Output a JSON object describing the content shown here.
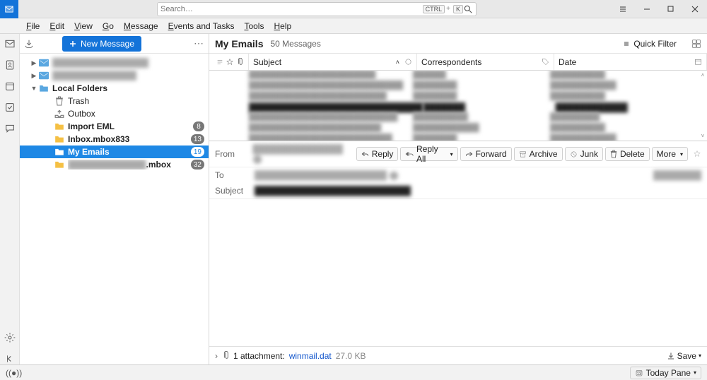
{
  "search": {
    "placeholder": "Search…",
    "kbd1": "CTRL",
    "kbd2": "K"
  },
  "menu": {
    "file": "File",
    "edit": "Edit",
    "view": "View",
    "go": "Go",
    "message": "Message",
    "events": "Events and Tasks",
    "tools": "Tools",
    "help": "Help"
  },
  "newMessage": "New Message",
  "tree": {
    "localFolders": "Local Folders",
    "trash": "Trash",
    "outbox": "Outbox",
    "importEML": {
      "label": "Import EML",
      "badge": "8"
    },
    "inboxMbox": {
      "label": "Inbox.mbox833",
      "badge": "13"
    },
    "myEmails": {
      "label": "My Emails",
      "badge": "19"
    },
    "hiddenMbox": {
      "suffix": ".mbox",
      "badge": "32"
    }
  },
  "main": {
    "title": "My Emails",
    "count": "50 Messages",
    "quickFilter": "Quick Filter",
    "cols": {
      "subject": "Subject",
      "corr": "Correspondents",
      "date": "Date"
    }
  },
  "preview": {
    "from": "From",
    "to": "To",
    "subject": "Subject",
    "btns": {
      "reply": "Reply",
      "replyAll": "Reply All",
      "forward": "Forward",
      "archive": "Archive",
      "junk": "Junk",
      "delete": "Delete",
      "more": "More"
    }
  },
  "attachment": {
    "label": "1 attachment:",
    "name": "winmail.dat",
    "size": "27.0 KB",
    "save": "Save"
  },
  "status": {
    "todayPane": "Today Pane"
  }
}
